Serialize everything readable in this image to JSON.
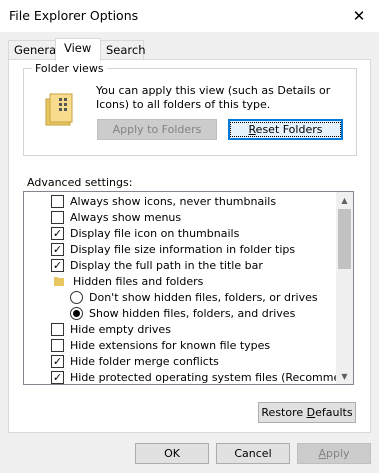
{
  "window": {
    "title": "File Explorer Options"
  },
  "tabs": [
    {
      "label": "General"
    },
    {
      "label": "View"
    },
    {
      "label": "Search"
    }
  ],
  "folder_views": {
    "legend": "Folder views",
    "description": "You can apply this view (such as Details or Icons) to all folders of this type.",
    "apply_button": "Apply to Folders",
    "reset_button_pre": "",
    "reset_button_mnemonic": "R",
    "reset_button_post": "eset Folders"
  },
  "advanced": {
    "label": "Advanced settings:",
    "items": [
      {
        "kind": "checkbox",
        "checked": false,
        "label": "Always show icons, never thumbnails"
      },
      {
        "kind": "checkbox",
        "checked": false,
        "label": "Always show menus"
      },
      {
        "kind": "checkbox",
        "checked": true,
        "label": "Display file icon on thumbnails"
      },
      {
        "kind": "checkbox",
        "checked": true,
        "label": "Display file size information in folder tips"
      },
      {
        "kind": "checkbox",
        "checked": true,
        "label": "Display the full path in the title bar"
      },
      {
        "kind": "folder",
        "label": "Hidden files and folders"
      },
      {
        "kind": "radio",
        "checked": false,
        "label": "Don't show hidden files, folders, or drives"
      },
      {
        "kind": "radio",
        "checked": true,
        "label": "Show hidden files, folders, and drives"
      },
      {
        "kind": "checkbox",
        "checked": false,
        "label": "Hide empty drives"
      },
      {
        "kind": "checkbox",
        "checked": false,
        "label": "Hide extensions for known file types"
      },
      {
        "kind": "checkbox",
        "checked": true,
        "label": "Hide folder merge conflicts"
      },
      {
        "kind": "checkbox",
        "checked": true,
        "label": "Hide protected operating system files (Recommended)"
      }
    ]
  },
  "restore_button_pre": "Restore ",
  "restore_button_mnemonic": "D",
  "restore_button_post": "efaults",
  "footer": {
    "ok": "OK",
    "cancel": "Cancel",
    "apply_pre": "",
    "apply_mnemonic": "A",
    "apply_post": "pply"
  },
  "colors": {
    "accent": "#0078d7",
    "folder": "#e8c662"
  },
  "icons": {
    "close": "close-icon",
    "folder": "folder-icon",
    "check": "check-icon"
  }
}
